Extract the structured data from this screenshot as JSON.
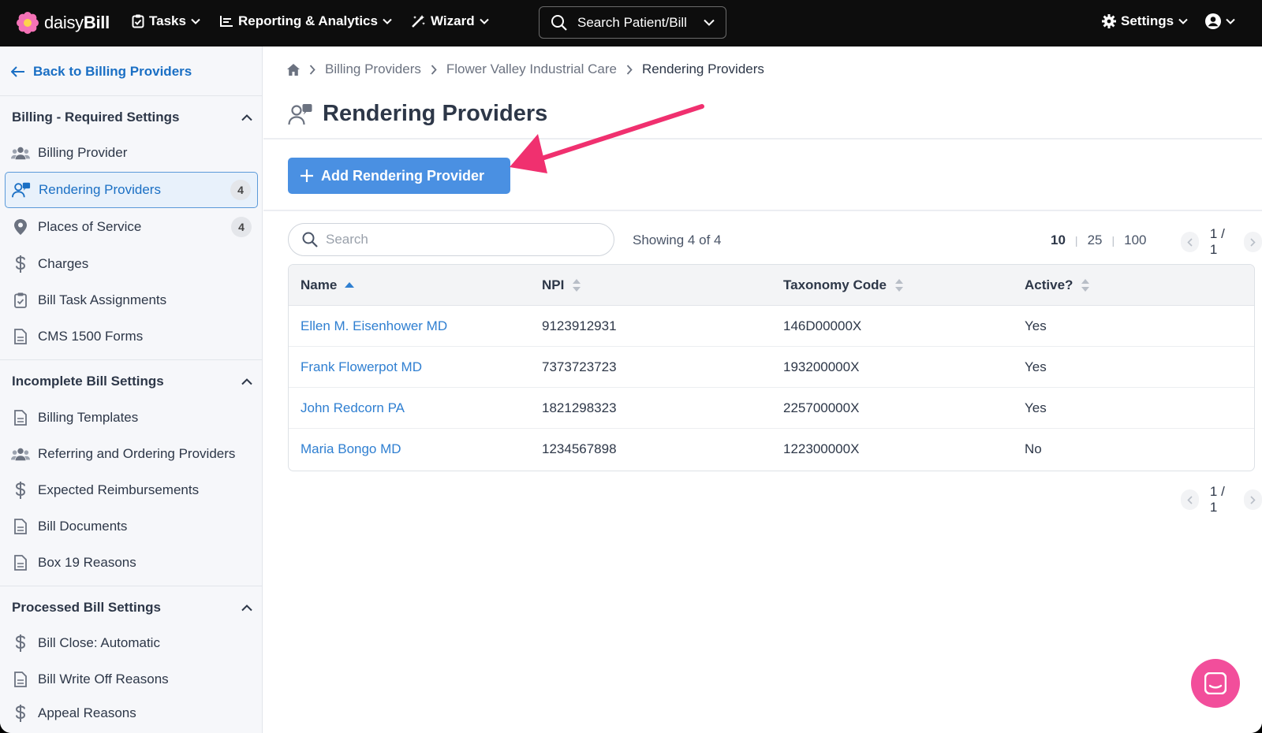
{
  "app": {
    "logo_text_light": "daisy",
    "logo_text_bold": "Bill"
  },
  "topnav": {
    "tasks": "Tasks",
    "reporting": "Reporting & Analytics",
    "wizard": "Wizard",
    "search_label": "Search Patient/Bill",
    "settings": "Settings"
  },
  "sidebar": {
    "back": "Back to Billing Providers",
    "sections": [
      {
        "title": "Billing - Required Settings"
      },
      {
        "title": "Incomplete Bill Settings"
      },
      {
        "title": "Processed Bill Settings"
      }
    ],
    "items": [
      {
        "label": "Billing Provider",
        "icon": "users-icon"
      },
      {
        "label": "Rendering Providers",
        "icon": "provider-icon",
        "badge": "4",
        "active": true
      },
      {
        "label": "Places of Service",
        "icon": "map-pin-icon",
        "badge": "4"
      },
      {
        "label": "Charges",
        "icon": "dollar-icon"
      },
      {
        "label": "Bill Task Assignments",
        "icon": "clipboard-check-icon"
      },
      {
        "label": "CMS 1500 Forms",
        "icon": "document-icon"
      },
      {
        "label": "Billing Templates",
        "icon": "document-icon"
      },
      {
        "label": "Referring and Ordering Providers",
        "icon": "users-icon"
      },
      {
        "label": "Expected Reimbursements",
        "icon": "dollar-icon"
      },
      {
        "label": "Bill Documents",
        "icon": "document-icon"
      },
      {
        "label": "Box 19 Reasons",
        "icon": "document-icon"
      },
      {
        "label": "Bill Close: Automatic",
        "icon": "dollar-icon"
      },
      {
        "label": "Bill Write Off Reasons",
        "icon": "document-icon"
      },
      {
        "label": "Appeal Reasons",
        "icon": "dollar-icon"
      }
    ]
  },
  "breadcrumb": {
    "items": [
      "Billing Providers",
      "Flower Valley Industrial Care"
    ],
    "current": "Rendering Providers"
  },
  "page": {
    "title": "Rendering Providers",
    "add_button": "Add Rendering Provider"
  },
  "table": {
    "search_placeholder": "Search",
    "showing": "Showing 4 of 4",
    "page_sizes": [
      "10",
      "25",
      "100"
    ],
    "selected_page_size": "10",
    "page_indicator": "1 / 1",
    "columns": [
      "Name",
      "NPI",
      "Taxonomy Code",
      "Active?"
    ],
    "rows": [
      {
        "name": "Ellen M. Eisenhower MD",
        "npi": "9123912931",
        "taxonomy": "146D00000X",
        "active": "Yes"
      },
      {
        "name": "Frank Flowerpot MD",
        "npi": "7373723723",
        "taxonomy": "193200000X",
        "active": "Yes"
      },
      {
        "name": "John Redcorn PA",
        "npi": "1821298323",
        "taxonomy": "225700000X",
        "active": "Yes"
      },
      {
        "name": "Maria Bongo MD",
        "npi": "1234567898",
        "taxonomy": "122300000X",
        "active": "No"
      }
    ]
  },
  "colors": {
    "accent": "#4a90e2",
    "link": "#2f7fd1",
    "annotation_arrow": "#f0306f",
    "chat_button": "#f24e9b"
  }
}
